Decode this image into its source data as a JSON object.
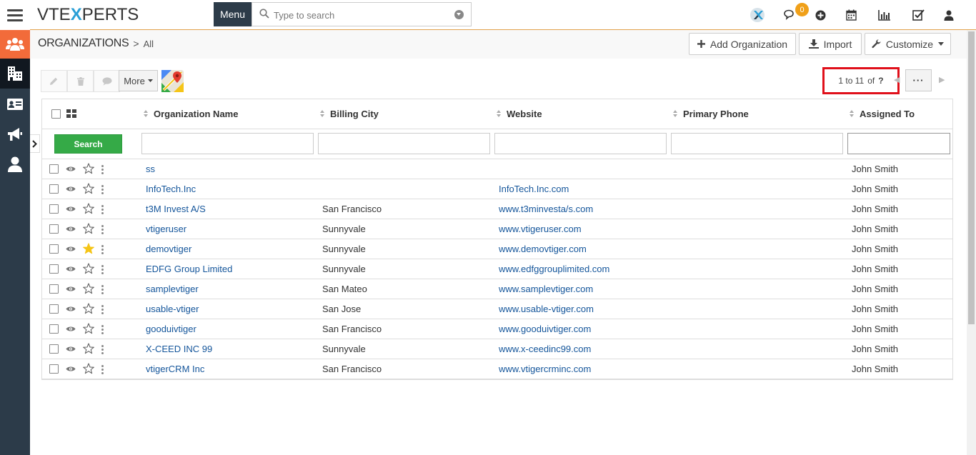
{
  "topbar": {
    "logo_left": "VTE",
    "logo_x": "X",
    "logo_right": "PERTS",
    "menu_label": "Menu",
    "search_placeholder": "Type to search",
    "notification_count": "0",
    "icons": [
      "vtexperts-icon",
      "chat-icon",
      "plus-circle-icon",
      "calendar-icon",
      "bar-chart-icon",
      "task-check-icon",
      "user-icon"
    ]
  },
  "sidebar": {
    "items": [
      "organizations-group-icon",
      "building-icon",
      "contact-card-icon",
      "megaphone-icon",
      "person-icon"
    ]
  },
  "header": {
    "module": "ORGANIZATIONS",
    "separator": ">",
    "view": "All",
    "add_label": "Add Organization",
    "import_label": "Import",
    "customize_label": "Customize"
  },
  "toolbar": {
    "more_label": "More"
  },
  "pager": {
    "range": "1 to 11",
    "of": "of",
    "total": "?",
    "dots": "···"
  },
  "table": {
    "columns": [
      "Organization Name",
      "Billing City",
      "Website",
      "Primary Phone",
      "Assigned To"
    ],
    "search_label": "Search",
    "rows": [
      {
        "name": "ss",
        "city": "",
        "website": "",
        "phone": "",
        "assigned": "John Smith",
        "starred": false
      },
      {
        "name": "InfoTech.Inc",
        "city": "",
        "website": "InfoTech.Inc.com",
        "phone": "",
        "assigned": "John Smith",
        "starred": false
      },
      {
        "name": "t3M Invest A/S",
        "city": "San Francisco",
        "website": "www.t3minvesta/s.com",
        "phone": "",
        "assigned": "John Smith",
        "starred": false
      },
      {
        "name": "vtigeruser",
        "city": "Sunnyvale",
        "website": "www.vtigeruser.com",
        "phone": "",
        "assigned": "John Smith",
        "starred": false
      },
      {
        "name": "demovtiger",
        "city": "Sunnyvale",
        "website": "www.demovtiger.com",
        "phone": "",
        "assigned": "John Smith",
        "starred": true
      },
      {
        "name": "EDFG Group Limited",
        "city": "Sunnyvale",
        "website": "www.edfggrouplimited.com",
        "phone": "",
        "assigned": "John Smith",
        "starred": false
      },
      {
        "name": "samplevtiger",
        "city": "San Mateo",
        "website": "www.samplevtiger.com",
        "phone": "",
        "assigned": "John Smith",
        "starred": false
      },
      {
        "name": "usable-vtiger",
        "city": "San Jose",
        "website": "www.usable-vtiger.com",
        "phone": "",
        "assigned": "John Smith",
        "starred": false
      },
      {
        "name": "gooduivtiger",
        "city": "San Francisco",
        "website": "www.gooduivtiger.com",
        "phone": "",
        "assigned": "John Smith",
        "starred": false
      },
      {
        "name": "X-CEED INC 99",
        "city": "Sunnyvale",
        "website": "www.x-ceedinc99.com",
        "phone": "",
        "assigned": "John Smith",
        "starred": false
      },
      {
        "name": "vtigerCRM Inc",
        "city": "San Francisco",
        "website": "www.vtigercrminc.com",
        "phone": "",
        "assigned": "John Smith",
        "starred": false
      }
    ]
  },
  "colors": {
    "sidebar_bg": "#2c3b49",
    "accent_orange": "#f0a019",
    "active_module": "#f26b3a",
    "search_green": "#35aa47",
    "link_blue": "#15569b",
    "highlight_red": "#e0101a",
    "star_gold": "#f5c518"
  }
}
